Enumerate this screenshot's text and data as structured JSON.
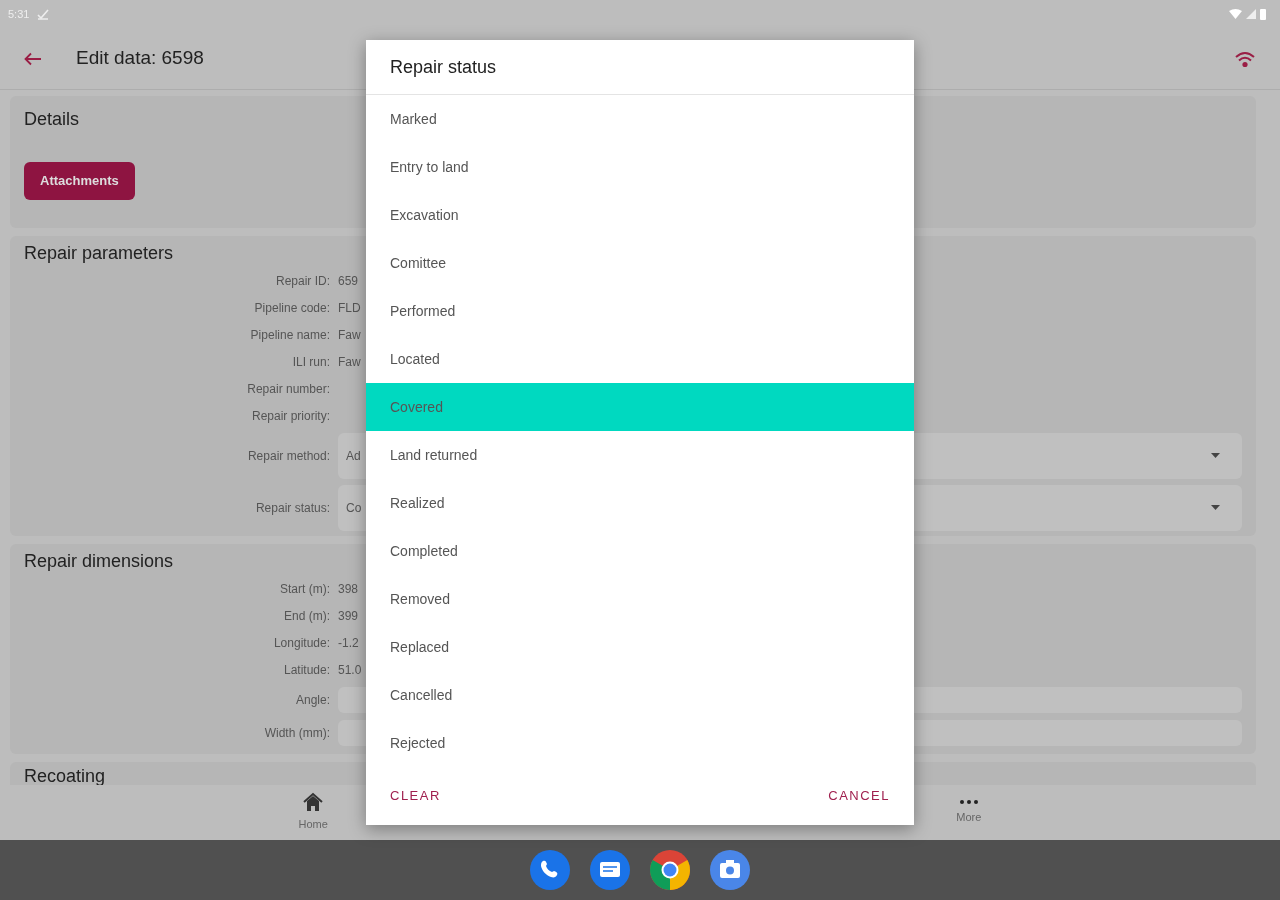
{
  "status_bar": {
    "time": "5:31"
  },
  "app_bar": {
    "title": "Edit data: 6598"
  },
  "details": {
    "title": "Details",
    "button": "Attachments"
  },
  "repair_parameters": {
    "title": "Repair parameters",
    "fields": [
      {
        "label": "Repair ID:",
        "value": "659",
        "kind": "text"
      },
      {
        "label": "Pipeline code:",
        "value": "FLD",
        "kind": "text"
      },
      {
        "label": "Pipeline name:",
        "value": "Faw",
        "kind": "text"
      },
      {
        "label": "ILI run:",
        "value": "Faw",
        "kind": "text"
      },
      {
        "label": "Repair number:",
        "kind": "text"
      },
      {
        "label": "Repair priority:",
        "kind": "text"
      },
      {
        "label": "Repair method:",
        "value": "Ad",
        "kind": "select"
      },
      {
        "label": "Repair status:",
        "value": "Co",
        "kind": "select"
      }
    ]
  },
  "repair_dimensions": {
    "title": "Repair dimensions",
    "fields": [
      {
        "label": "Start (m):",
        "value": "398",
        "kind": "text"
      },
      {
        "label": "End (m):",
        "value": "399",
        "kind": "text"
      },
      {
        "label": "Longitude:",
        "value": "-1.2",
        "kind": "text"
      },
      {
        "label": "Latitude:",
        "value": "51.0",
        "kind": "text"
      },
      {
        "label": "Angle:",
        "kind": "input"
      },
      {
        "label": "Width (mm):",
        "kind": "input"
      }
    ]
  },
  "recoating": {
    "title": "Recoating"
  },
  "bottom_nav": [
    {
      "label": "Home",
      "kind": "home"
    },
    {
      "label": "More",
      "kind": "more"
    }
  ],
  "dialog": {
    "title": "Repair status",
    "options": [
      {
        "label": "Marked",
        "selected": false
      },
      {
        "label": "Entry to land",
        "selected": false
      },
      {
        "label": "Excavation",
        "selected": false
      },
      {
        "label": "Comittee",
        "selected": false
      },
      {
        "label": "Performed",
        "selected": false
      },
      {
        "label": "Located",
        "selected": false
      },
      {
        "label": "Covered",
        "selected": true
      },
      {
        "label": "Land returned",
        "selected": false
      },
      {
        "label": "Realized",
        "selected": false
      },
      {
        "label": "Completed",
        "selected": false
      },
      {
        "label": "Removed",
        "selected": false
      },
      {
        "label": "Replaced",
        "selected": false
      },
      {
        "label": "Cancelled",
        "selected": false
      },
      {
        "label": "Rejected",
        "selected": false
      }
    ],
    "clear_button": "CLEAR",
    "cancel_button": "CANCEL"
  }
}
